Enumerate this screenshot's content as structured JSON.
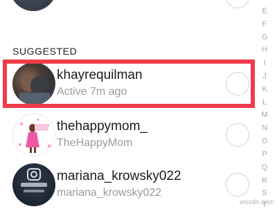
{
  "section": {
    "title": "SUGGESTED"
  },
  "suggestions": [
    {
      "username": "khayrequilman",
      "subtitle": "Active 7m ago"
    },
    {
      "username": "thehappymom_",
      "subtitle": "TheHappyMom"
    },
    {
      "username": "mariana_krowsky022",
      "subtitle": "mariana_krowsky022"
    }
  ],
  "alphabet_index": [
    "E",
    "F",
    "G",
    "H",
    "I",
    "J",
    "K",
    "L",
    "M",
    "N",
    "O",
    "P",
    "Q",
    "R",
    "S",
    "T"
  ],
  "watermark": "wsxdn.com",
  "colors": {
    "highlight": "#f03b4b",
    "subtitle_text": "#9a9a9a",
    "index_text": "#a8a8a8"
  }
}
